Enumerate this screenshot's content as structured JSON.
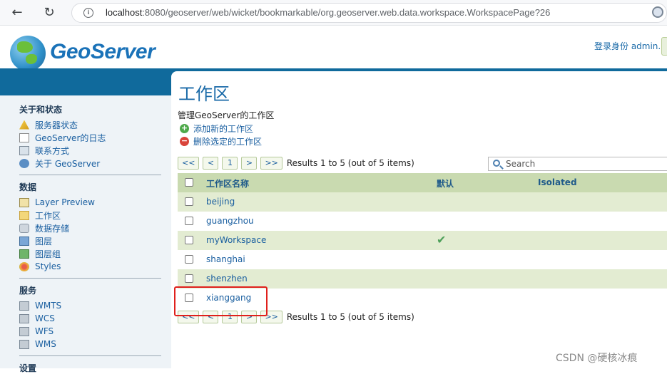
{
  "browser": {
    "url_host": "localhost",
    "url_rest": ":8080/geoserver/web/wicket/bookmarkable/org.geoserver.web.data.workspace.WorkspacePage?26"
  },
  "header": {
    "logo_text": "GeoServer",
    "login_text": "登录身份 admin."
  },
  "sidebar": {
    "sections": [
      {
        "title": "关于和状态",
        "items": [
          "服务器状态",
          "GeoServer的日志",
          "联系方式",
          "关于 GeoServer"
        ]
      },
      {
        "title": "数据",
        "items": [
          "Layer Preview",
          "工作区",
          "数据存储",
          "图层",
          "图层组",
          "Styles"
        ]
      },
      {
        "title": "服务",
        "items": [
          "WMTS",
          "WCS",
          "WFS",
          "WMS"
        ]
      },
      {
        "title": "设置",
        "items": []
      }
    ]
  },
  "main": {
    "title": "工作区",
    "description": "管理GeoServer的工作区",
    "add_link": "添加新的工作区",
    "remove_link": "删除选定的工作区",
    "pager": {
      "first": "<<",
      "prev": "<",
      "page": "1",
      "next": ">",
      "last": ">>",
      "results": "Results 1 to 5 (out of 5 items)"
    },
    "search_placeholder": "Search",
    "table": {
      "headers": {
        "name": "工作区名称",
        "default": "默认",
        "isolated": "Isolated"
      },
      "rows": [
        {
          "name": "beijing",
          "default": false
        },
        {
          "name": "guangzhou",
          "default": false
        },
        {
          "name": "myWorkspace",
          "default": true
        },
        {
          "name": "shanghai",
          "default": false
        },
        {
          "name": "shenzhen",
          "default": false
        },
        {
          "name": "xianggang",
          "default": false
        }
      ]
    }
  },
  "watermark": "CSDN @硬核冰痕",
  "colors": {
    "brand_blue": "#106a9c",
    "row_green": "#e3ecd2",
    "header_green": "#c9dab0",
    "highlight_red": "#e0201c"
  }
}
